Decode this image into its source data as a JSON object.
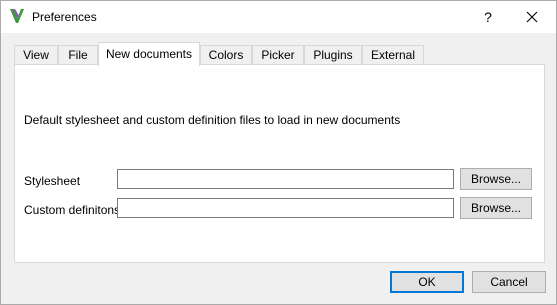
{
  "window": {
    "title": "Preferences",
    "help_symbol": "?"
  },
  "tabs": [
    {
      "label": "View"
    },
    {
      "label": "File"
    },
    {
      "label": "New documents"
    },
    {
      "label": "Colors"
    },
    {
      "label": "Picker"
    },
    {
      "label": "Plugins"
    },
    {
      "label": "External"
    }
  ],
  "active_tab": "New documents",
  "panel": {
    "description": "Default stylesheet and custom definition files to load in new documents",
    "stylesheet_label": "Stylesheet",
    "stylesheet_value": "",
    "custom_label": "Custom definitons",
    "custom_value": "",
    "browse_label": "Browse..."
  },
  "footer": {
    "ok_label": "OK",
    "cancel_label": "Cancel"
  },
  "colors": {
    "accent": "#0078d7",
    "icon_green": "#3a9a3a",
    "icon_purple": "#6a3d9a"
  }
}
